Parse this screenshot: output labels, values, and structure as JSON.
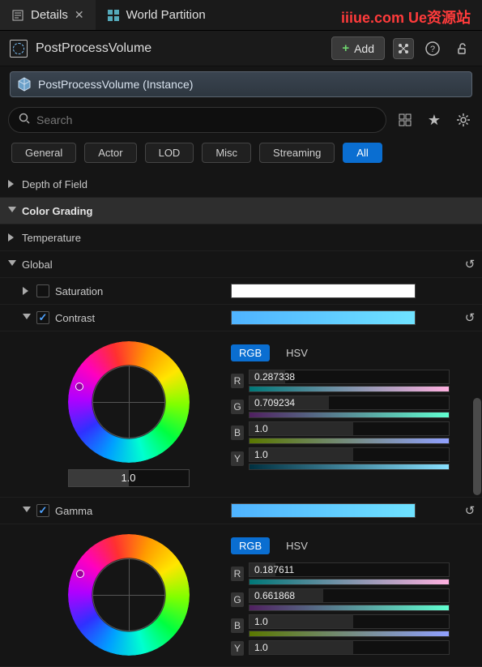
{
  "watermark": "iiiue.com  Ue资源站",
  "tabs": {
    "details": "Details",
    "worldPartition": "World Partition"
  },
  "title": "PostProcessVolume",
  "addBtn": "Add",
  "instance": "PostProcessVolume (Instance)",
  "search": {
    "placeholder": "Search"
  },
  "filters": {
    "general": "General",
    "actor": "Actor",
    "lod": "LOD",
    "misc": "Misc",
    "streaming": "Streaming",
    "all": "All"
  },
  "sections": {
    "depthOfField": "Depth of Field",
    "colorGrading": "Color Grading",
    "temperature": "Temperature",
    "global": "Global",
    "saturation": "Saturation",
    "contrast": "Contrast",
    "gamma": "Gamma"
  },
  "colorModes": {
    "rgb": "RGB",
    "hsv": "HSV"
  },
  "contrast": {
    "wheelValue": "1.0",
    "r": "0.287338",
    "g": "0.709234",
    "b": "1.0",
    "y": "1.0"
  },
  "gamma": {
    "r": "0.187611",
    "g": "0.661868",
    "b": "1.0",
    "y": "1.0"
  },
  "labels": {
    "r": "R",
    "g": "G",
    "b": "B",
    "y": "Y"
  }
}
